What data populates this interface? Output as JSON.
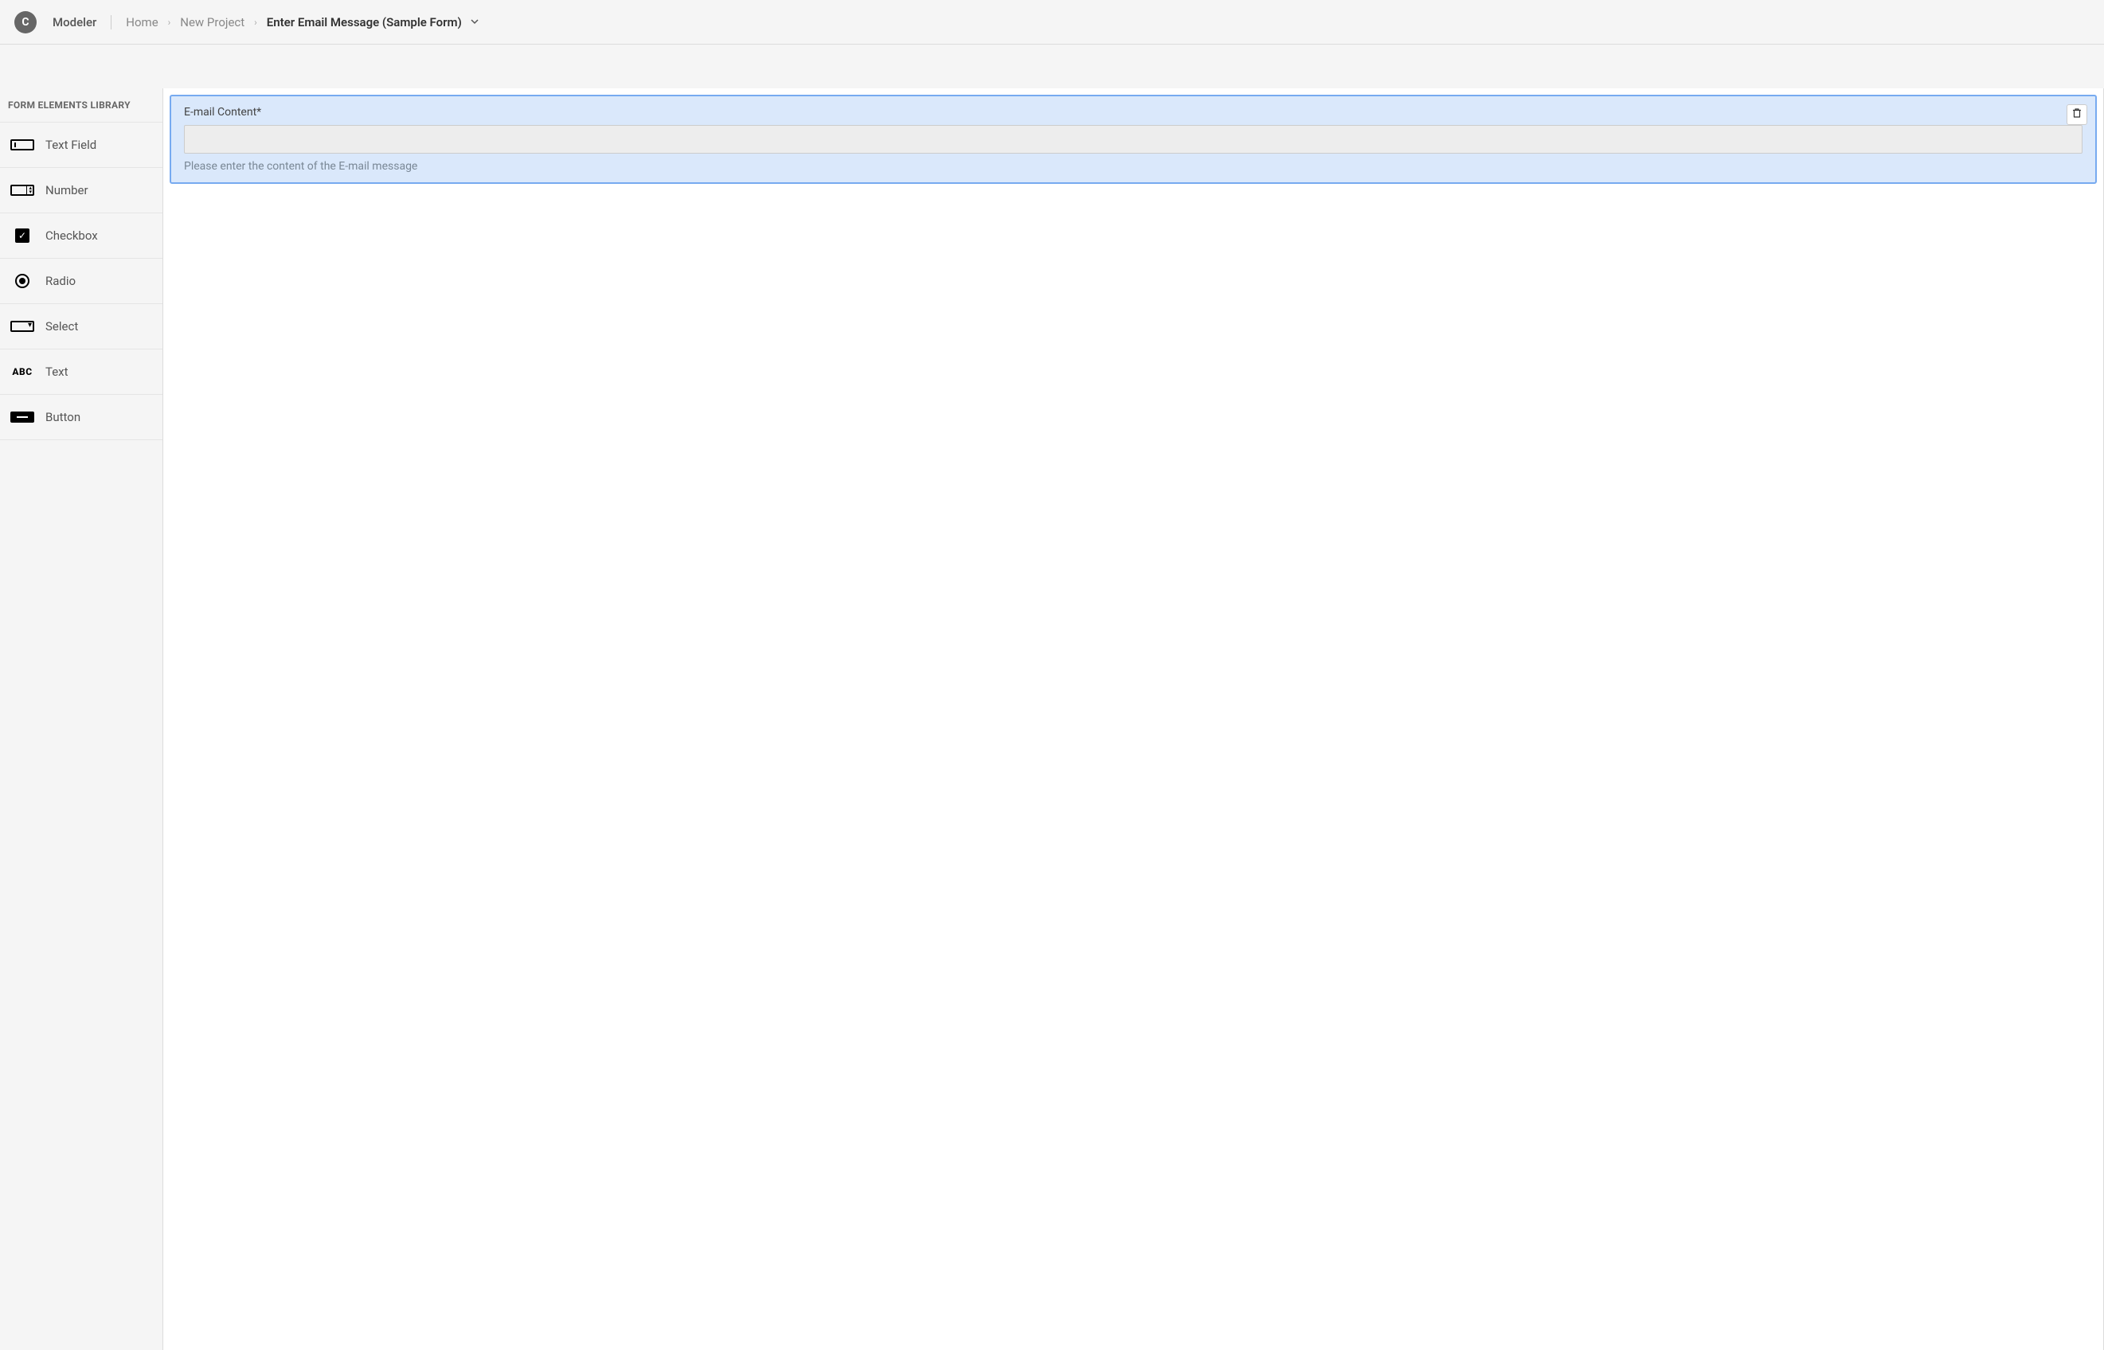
{
  "header": {
    "logo_letter": "C",
    "app_name": "Modeler",
    "breadcrumbs": [
      {
        "label": "Home",
        "active": false
      },
      {
        "label": "New Project",
        "active": false
      },
      {
        "label": "Enter Email Message (Sample Form)",
        "active": true
      }
    ]
  },
  "sidebar": {
    "title": "FORM ELEMENTS LIBRARY",
    "items": [
      {
        "label": "Text Field",
        "icon": "textfield"
      },
      {
        "label": "Number",
        "icon": "number"
      },
      {
        "label": "Checkbox",
        "icon": "checkbox"
      },
      {
        "label": "Radio",
        "icon": "radio"
      },
      {
        "label": "Select",
        "icon": "select"
      },
      {
        "label": "Text",
        "icon": "text"
      },
      {
        "label": "Button",
        "icon": "button"
      }
    ]
  },
  "canvas": {
    "selected_element": {
      "label": "E-mail Content*",
      "value": "",
      "hint": "Please enter the content of the E-mail message"
    }
  }
}
